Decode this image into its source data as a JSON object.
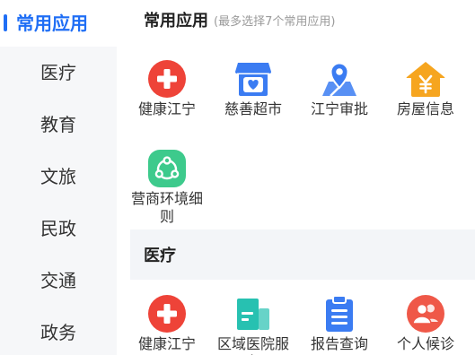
{
  "theme": {
    "accent": "#1f6ef5",
    "sidebar_bg": "#f6f7f9",
    "section_bg": "#f3f5f8"
  },
  "sidebar": {
    "items": [
      {
        "label": "常用应用",
        "selected": true
      },
      {
        "label": "医疗"
      },
      {
        "label": "教育"
      },
      {
        "label": "文旅"
      },
      {
        "label": "民政"
      },
      {
        "label": "交通"
      },
      {
        "label": "政务"
      }
    ]
  },
  "favorites": {
    "title": "常用应用",
    "hint": "(最多选择7个常用应用)",
    "apps": [
      {
        "label": "健康江宁",
        "icon": "medical-cross-icon",
        "color": "#ee4338"
      },
      {
        "label": "慈善超市",
        "icon": "charity-shop-icon",
        "color": "#3b7cf2"
      },
      {
        "label": "江宁审批",
        "icon": "map-pin-icon",
        "color": "#3b7cf2"
      },
      {
        "label": "房屋信息",
        "icon": "house-yuan-icon",
        "color": "#f6a51f"
      },
      {
        "label": "营商环境细则",
        "icon": "circular-arrows-icon",
        "color": "#3dca8c"
      }
    ]
  },
  "sections": [
    {
      "title": "医疗",
      "apps": [
        {
          "label": "健康江宁",
          "icon": "medical-cross-icon",
          "color": "#ee4338"
        },
        {
          "label": "区域医院服务",
          "icon": "hospital-card-icon",
          "color": "#27c1b1"
        },
        {
          "label": "报告查询",
          "icon": "clipboard-icon",
          "color": "#3b7cf2"
        },
        {
          "label": "个人候诊",
          "icon": "people-icon",
          "color": "#ef5848"
        }
      ]
    }
  ]
}
